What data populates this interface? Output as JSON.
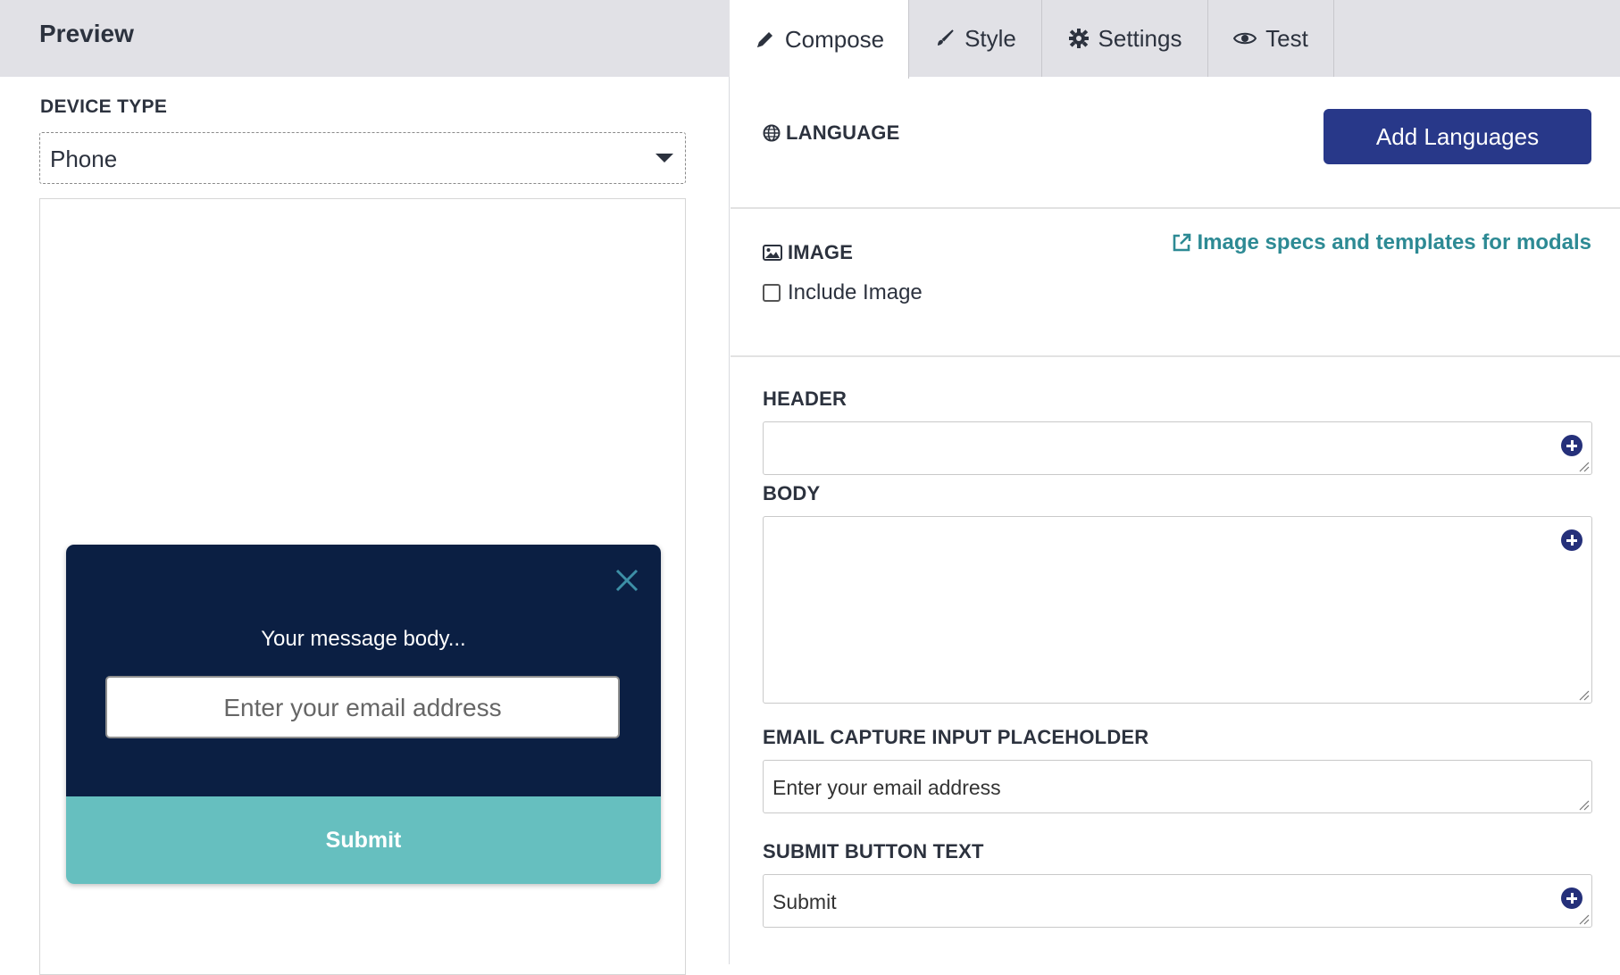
{
  "preview": {
    "title": "Preview",
    "device_label": "DEVICE TYPE",
    "device_value": "Phone",
    "modal": {
      "body_text": "Your message body...",
      "email_placeholder": "Enter your email address",
      "submit_label": "Submit",
      "bg_color": "#0b1f43",
      "submit_color": "#66bfbf",
      "close_icon": "close-icon"
    }
  },
  "tabs": [
    {
      "label": "Compose",
      "icon": "pencil-icon",
      "active": true
    },
    {
      "label": "Style",
      "icon": "brush-icon",
      "active": false
    },
    {
      "label": "Settings",
      "icon": "gear-icon",
      "active": false
    },
    {
      "label": "Test",
      "icon": "eye-icon",
      "active": false
    }
  ],
  "language": {
    "label": "LANGUAGE",
    "icon": "globe-icon",
    "add_button": "Add Languages",
    "button_color": "#283889"
  },
  "image": {
    "label": "IMAGE",
    "icon": "image-icon",
    "link_text": "Image specs and templates for modals",
    "link_icon": "external-link-icon",
    "link_color": "#2d8a94",
    "checkbox_label": "Include Image",
    "checked": false
  },
  "fields": {
    "header_label": "HEADER",
    "header_value": "",
    "body_label": "BODY",
    "body_value": "",
    "email_label": "EMAIL CAPTURE INPUT PLACEHOLDER",
    "email_value": "Enter your email address",
    "submit_label": "SUBMIT BUTTON TEXT",
    "submit_value": "Submit"
  }
}
